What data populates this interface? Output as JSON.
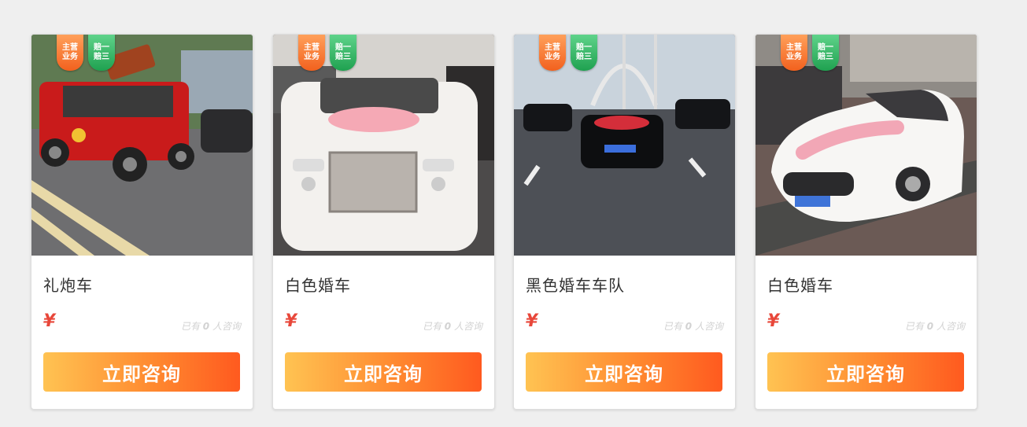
{
  "products": [
    {
      "title": "礼炮车",
      "badge_main": [
        "主营",
        "业务"
      ],
      "badge_pay": [
        "赔一",
        "赔三"
      ],
      "price_symbol": "¥",
      "inquiry_prefix": "已有",
      "inquiry_count": "0",
      "inquiry_suffix": "人咨询",
      "button_label": "立即咨询",
      "image": "red-jeep-salute-car"
    },
    {
      "title": "白色婚车",
      "badge_main": [
        "主营",
        "业务"
      ],
      "badge_pay": [
        "赔一",
        "赔三"
      ],
      "price_symbol": "¥",
      "inquiry_prefix": "已有",
      "inquiry_count": "0",
      "inquiry_suffix": "人咨询",
      "button_label": "立即咨询",
      "image": "white-rolls-royce-wedding-car"
    },
    {
      "title": "黑色婚车车队",
      "badge_main": [
        "主营",
        "业务"
      ],
      "badge_pay": [
        "赔一",
        "赔三"
      ],
      "price_symbol": "¥",
      "inquiry_prefix": "已有",
      "inquiry_count": "0",
      "inquiry_suffix": "人咨询",
      "button_label": "立即咨询",
      "image": "black-wedding-car-fleet-on-bridge"
    },
    {
      "title": "白色婚车",
      "badge_main": [
        "主营",
        "业务"
      ],
      "badge_pay": [
        "赔一",
        "赔三"
      ],
      "price_symbol": "¥",
      "inquiry_prefix": "已有",
      "inquiry_count": "0",
      "inquiry_suffix": "人咨询",
      "button_label": "立即咨询",
      "image": "white-maserati-wedding-car"
    }
  ],
  "colors": {
    "price": "#e8473a",
    "button_start": "#ffc352",
    "button_end": "#ff5a1f",
    "badge_orange": "#f2611e",
    "badge_green": "#1fa150"
  }
}
